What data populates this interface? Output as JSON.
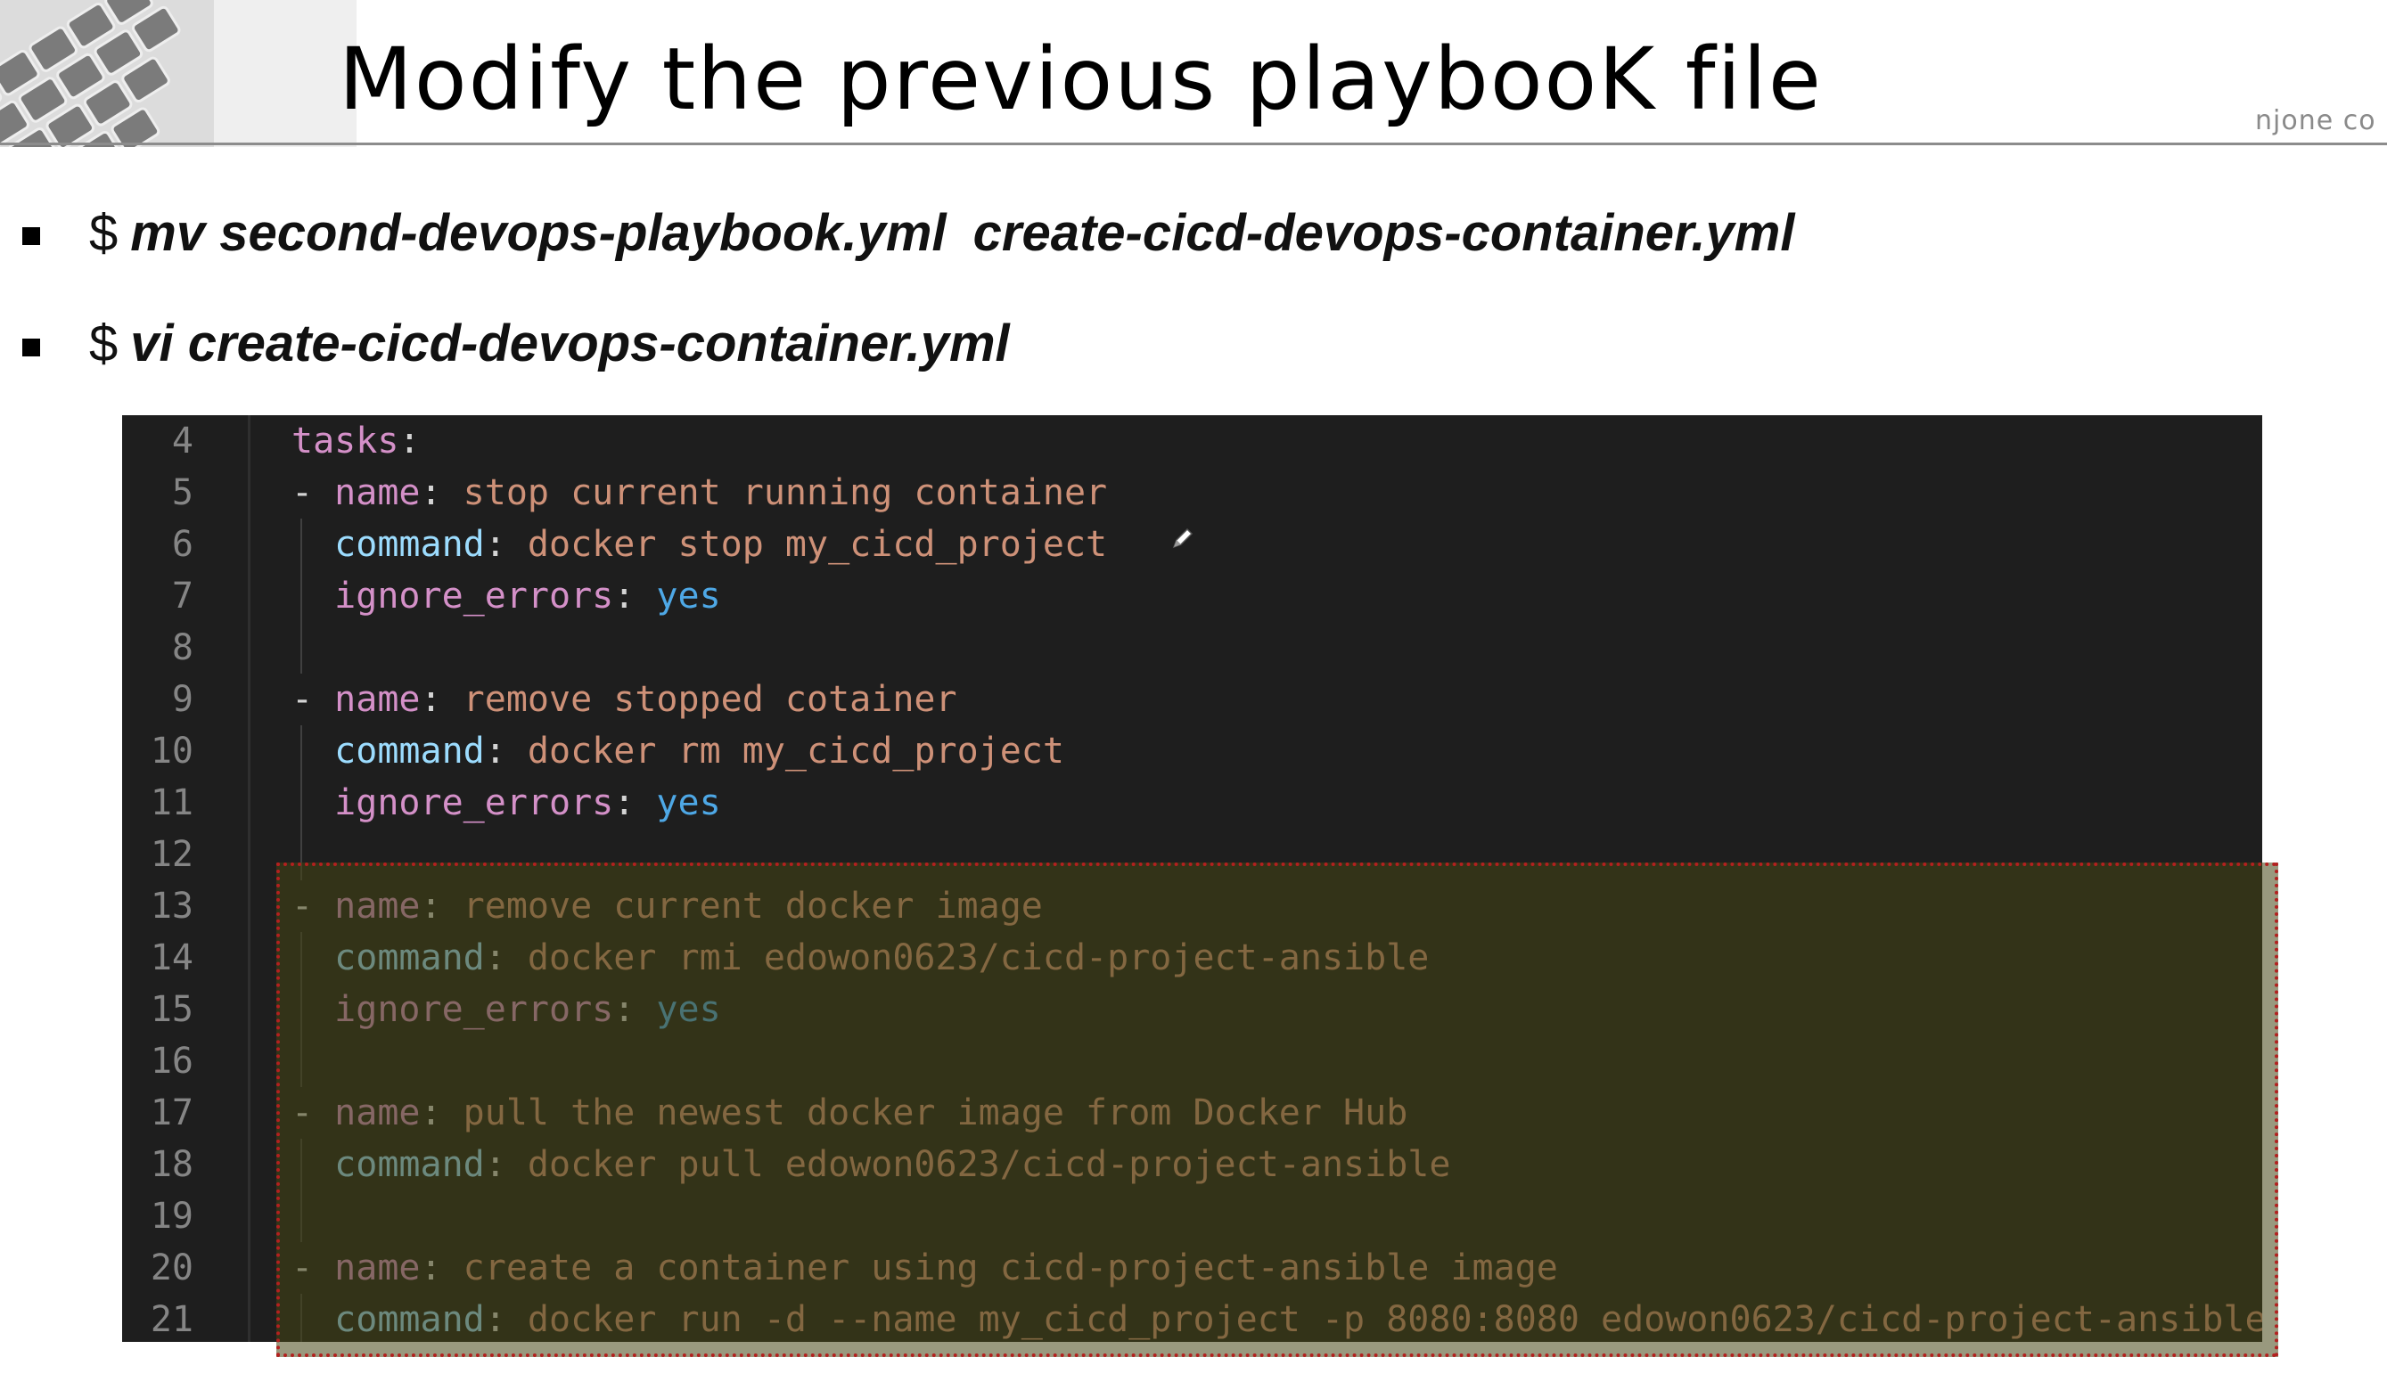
{
  "slide": {
    "title": "Modify the previous playbooK file",
    "watermark": "njone co",
    "commands": [
      {
        "prompt": "$",
        "text_a": "mv  second-devops-playbook.yml",
        "text_b": "create-cicd-devops-container.yml"
      },
      {
        "prompt": "$",
        "text_a": "vi create-cicd-devops-container.yml",
        "text_b": ""
      }
    ]
  },
  "editor": {
    "lines": [
      {
        "n": "4",
        "dash": "",
        "key": "tasks",
        "key_style": "pink",
        "sep": ":",
        "val": "",
        "val_style": "str"
      },
      {
        "n": "5",
        "dash": "- ",
        "key": "name",
        "key_style": "pink",
        "sep": ": ",
        "val": "stop current running container",
        "val_style": "str"
      },
      {
        "n": "6",
        "dash": "",
        "key": "command",
        "key_style": "cyan",
        "sep": ": ",
        "val": "docker stop my_cicd_project",
        "val_style": "str"
      },
      {
        "n": "7",
        "dash": "",
        "key": "ignore_errors",
        "key_style": "pink",
        "sep": ": ",
        "val": "yes",
        "val_style": "blue"
      },
      {
        "n": "8",
        "dash": "",
        "key": "",
        "key_style": "pink",
        "sep": "",
        "val": "",
        "val_style": "str"
      },
      {
        "n": "9",
        "dash": "- ",
        "key": "name",
        "key_style": "pink",
        "sep": ": ",
        "val": "remove stopped cotainer",
        "val_style": "str"
      },
      {
        "n": "10",
        "dash": "",
        "key": "command",
        "key_style": "cyan",
        "sep": ": ",
        "val": "docker rm my_cicd_project",
        "val_style": "str"
      },
      {
        "n": "11",
        "dash": "",
        "key": "ignore_errors",
        "key_style": "pink",
        "sep": ": ",
        "val": "yes",
        "val_style": "blue"
      },
      {
        "n": "12",
        "dash": "",
        "key": "",
        "key_style": "pink",
        "sep": "",
        "val": "",
        "val_style": "str"
      },
      {
        "n": "13",
        "dash": "- ",
        "key": "name",
        "key_style": "pink",
        "sep": ": ",
        "val": "remove current docker image",
        "val_style": "str"
      },
      {
        "n": "14",
        "dash": "",
        "key": "command",
        "key_style": "cyan",
        "sep": ": ",
        "val": "docker rmi edowon0623/cicd-project-ansible",
        "val_style": "str"
      },
      {
        "n": "15",
        "dash": "",
        "key": "ignore_errors",
        "key_style": "pink",
        "sep": ": ",
        "val": "yes",
        "val_style": "blue"
      },
      {
        "n": "16",
        "dash": "",
        "key": "",
        "key_style": "pink",
        "sep": "",
        "val": "",
        "val_style": "str"
      },
      {
        "n": "17",
        "dash": "- ",
        "key": "name",
        "key_style": "pink",
        "sep": ": ",
        "val": "pull the newest docker image from Docker Hub",
        "val_style": "str"
      },
      {
        "n": "18",
        "dash": "",
        "key": "command",
        "key_style": "cyan",
        "sep": ": ",
        "val": "docker pull edowon0623/cicd-project-ansible",
        "val_style": "str"
      },
      {
        "n": "19",
        "dash": "",
        "key": "",
        "key_style": "pink",
        "sep": "",
        "val": "",
        "val_style": "str"
      },
      {
        "n": "20",
        "dash": "- ",
        "key": "name",
        "key_style": "pink",
        "sep": ": ",
        "val": "create a container using cicd-project-ansible image",
        "val_style": "str"
      },
      {
        "n": "21",
        "dash": "",
        "key": "command",
        "key_style": "cyan",
        "sep": ": ",
        "val": "docker run -d --name my_cicd_project -p 8080:8080 edowon0623/cicd-project-ansible",
        "val_style": "str"
      }
    ]
  },
  "colors": {
    "editor_bg": "#1e1e1e",
    "highlight_border": "#b3201f",
    "highlight_fill": "#46461a"
  },
  "icons": {
    "cursor": "pencil-cursor-icon",
    "decoration": "laptop-keyboard-icon"
  }
}
